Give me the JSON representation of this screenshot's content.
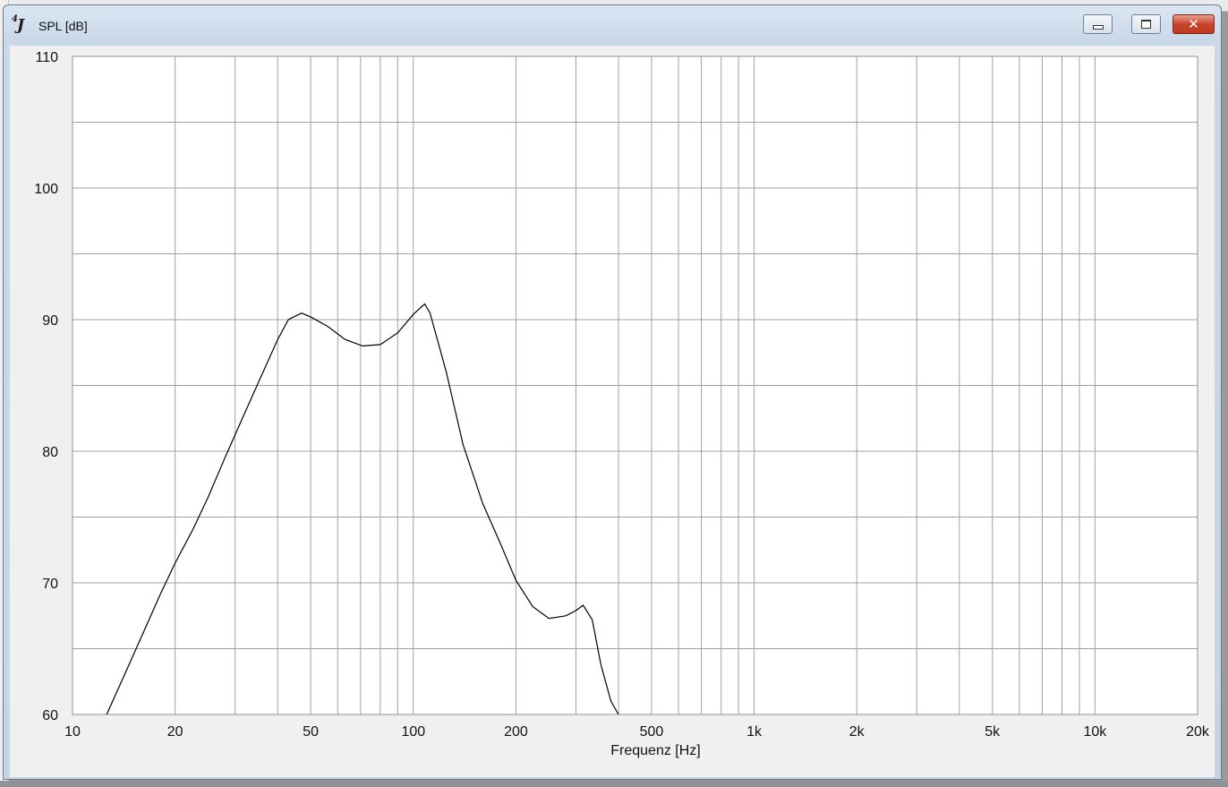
{
  "window": {
    "title": "SPL [dB]",
    "icon": "4J-app-icon",
    "buttons": {
      "minimize": "minimize",
      "maximize": "maximize",
      "close": "✕"
    }
  },
  "chart_data": {
    "type": "line",
    "title": "",
    "xlabel": "Frequenz [Hz]",
    "ylabel": "",
    "x_scale": "log",
    "xlim": [
      10,
      20000
    ],
    "ylim": [
      60,
      110
    ],
    "grid": true,
    "legend": "none",
    "x_ticks": [
      10,
      20,
      50,
      100,
      200,
      500,
      1000,
      2000,
      5000,
      10000,
      20000
    ],
    "x_tick_labels": [
      "10",
      "20",
      "50",
      "100",
      "200",
      "500",
      "1k",
      "2k",
      "5k",
      "10k",
      "20k"
    ],
    "y_ticks": [
      60,
      70,
      80,
      90,
      100,
      110
    ],
    "y_tick_labels": [
      "60",
      "70",
      "80",
      "90",
      "100",
      "110"
    ],
    "series": [
      {
        "color": "#000000",
        "x": [
          12.6,
          14.2,
          16,
          18,
          20,
          22.5,
          25,
          28,
          31.5,
          35.5,
          40,
          43,
          47,
          50,
          56,
          63,
          71,
          80,
          90,
          100,
          108,
          112,
          125,
          140,
          160,
          180,
          200,
          224,
          250,
          280,
          300,
          315,
          335,
          355,
          380,
          400
        ],
        "y": [
          60,
          63,
          66,
          69,
          71.5,
          74,
          76.5,
          79.5,
          82.5,
          85.5,
          88.5,
          90,
          90.5,
          90.2,
          89.5,
          88.5,
          88,
          88.1,
          89,
          90.4,
          91.2,
          90.5,
          86,
          80.5,
          76,
          73,
          70.2,
          68.2,
          67.3,
          67.5,
          67.9,
          68.3,
          67.2,
          63.8,
          61,
          60
        ]
      }
    ]
  }
}
